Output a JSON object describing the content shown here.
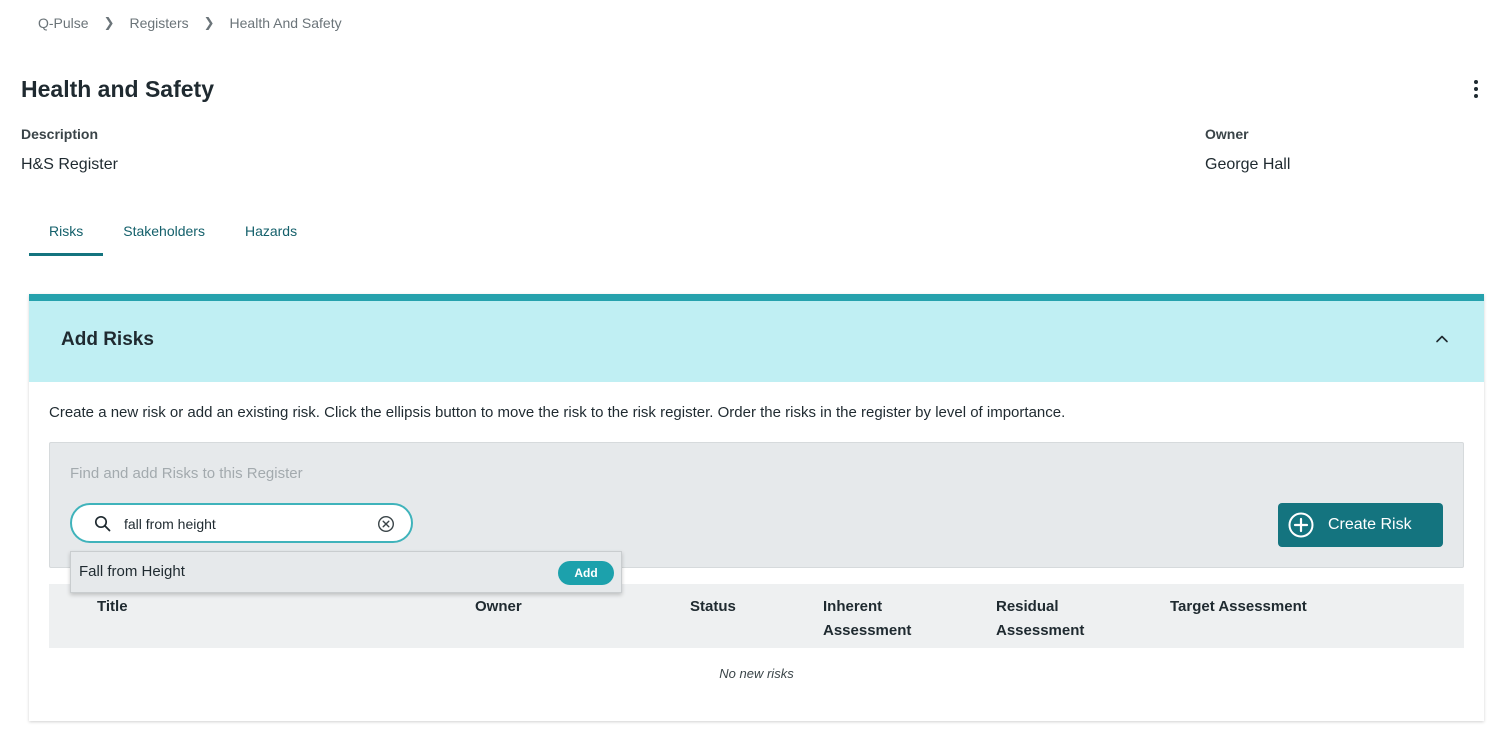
{
  "breadcrumb": [
    "Q-Pulse",
    "Registers",
    "Health And Safety"
  ],
  "page": {
    "title": "Health and Safety",
    "description_label": "Description",
    "description_value": "H&S Register",
    "owner_label": "Owner",
    "owner_value": "George Hall"
  },
  "tabs": [
    {
      "label": "Risks",
      "active": true
    },
    {
      "label": "Stakeholders",
      "active": false
    },
    {
      "label": "Hazards",
      "active": false
    }
  ],
  "add_risks": {
    "title": "Add Risks",
    "instructions": "Create a new risk or add an existing risk. Click the ellipsis button to move the risk to the risk register. Order the risks in the register by level of importance.",
    "search_heading": "Find and add Risks to this Register",
    "search_value": "fall from height",
    "create_label": "Create Risk",
    "results": [
      {
        "title": "Fall from Height",
        "action": "Add"
      }
    ],
    "columns": [
      "Title",
      "Owner",
      "Status",
      "Inherent Assessment",
      "Residual Assessment",
      "Target Assessment"
    ],
    "empty_message": "No new risks"
  },
  "colors": {
    "accent": "#14747f",
    "header_band": "#c0eff3",
    "panel_border": "#26a2ad"
  },
  "icons": {
    "breadcrumb_separator": "chevron-right-icon",
    "menu": "more-vertical-icon",
    "collapse": "chevron-up-icon",
    "search": "search-icon",
    "clear": "clear-circle-icon",
    "create": "plus-circle-icon"
  }
}
